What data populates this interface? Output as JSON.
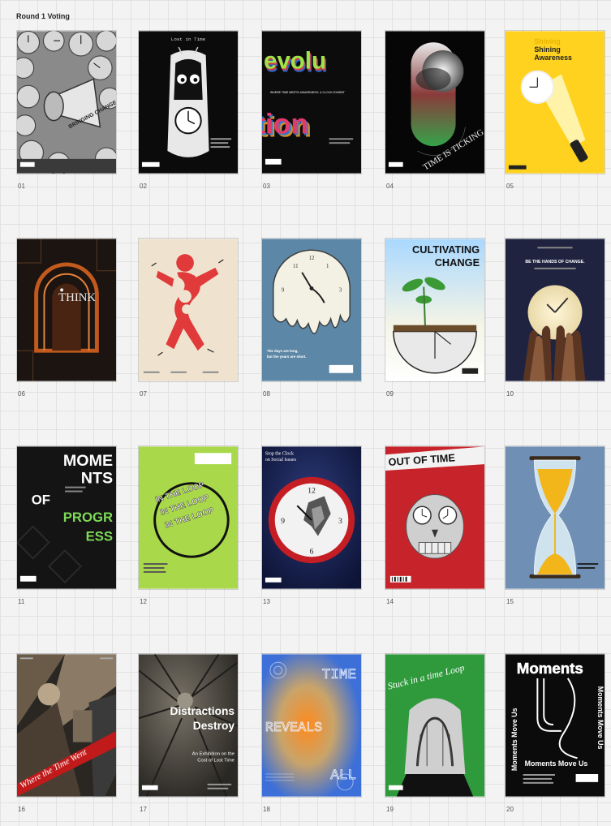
{
  "board": {
    "title": "Round 1 Voting"
  },
  "posters": [
    {
      "number": "01",
      "texts": [
        "BRINGING CHANGE FOR CLOCKS"
      ]
    },
    {
      "number": "02",
      "texts": [
        "Lost in Time"
      ]
    },
    {
      "number": "03",
      "texts": [
        "evolu",
        "tion",
        "WHERE TIME MEETS AWARENESS: A CLOCK EXHIBIT"
      ]
    },
    {
      "number": "04",
      "texts": [
        "TIME IS TICKING"
      ]
    },
    {
      "number": "05",
      "texts": [
        "Shining",
        "Shining",
        "Awareness"
      ]
    },
    {
      "number": "06",
      "texts": [
        "THINK"
      ]
    },
    {
      "number": "07",
      "texts": []
    },
    {
      "number": "08",
      "texts": [
        "The days are long,",
        "but the years are short."
      ]
    },
    {
      "number": "09",
      "texts": [
        "CULTIVATING",
        "CHANGE"
      ]
    },
    {
      "number": "10",
      "texts": [
        "BE THE HANDS OF CHANGE."
      ]
    },
    {
      "number": "11",
      "texts": [
        "MOME",
        "NTS",
        "OF",
        "PROGR",
        "ESS"
      ]
    },
    {
      "number": "12",
      "texts": [
        "IN THE LOOP",
        "IN THE LOOP",
        "IN THE LOOP"
      ]
    },
    {
      "number": "13",
      "texts": [
        "Stop the Clock",
        "on Social Issues"
      ]
    },
    {
      "number": "14",
      "texts": [
        "OUT OF TIME"
      ]
    },
    {
      "number": "15",
      "texts": []
    },
    {
      "number": "16",
      "texts": [
        "Where the Time Went"
      ]
    },
    {
      "number": "17",
      "texts": [
        "Distractions",
        "Destroy",
        "An Exhibition on the",
        "Cost of Lost Time"
      ]
    },
    {
      "number": "18",
      "texts": [
        "TIME",
        "REVEALS",
        "ALL"
      ]
    },
    {
      "number": "19",
      "texts": [
        "Stuck in a time Loop"
      ]
    },
    {
      "number": "20",
      "texts": [
        "Moments",
        "Moments Move Us"
      ]
    }
  ]
}
